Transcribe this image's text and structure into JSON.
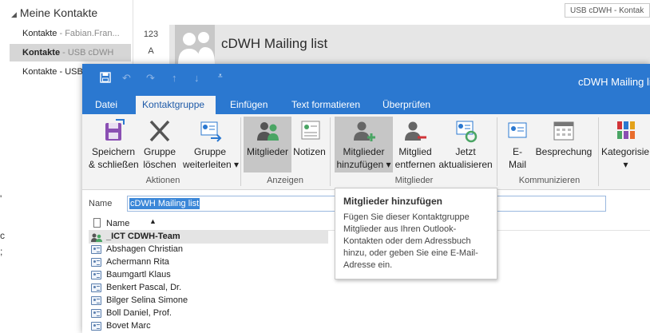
{
  "background": {
    "section_title": "Meine Kontakte",
    "contacts": [
      {
        "name": "Kontakte",
        "sub": " - Fabian.Fran..."
      },
      {
        "name": "Kontakte",
        "sub": " - USB cDWH"
      },
      {
        "name": "Kontakte - USB",
        "sub": ""
      }
    ],
    "index_letters": [
      "123",
      "A"
    ],
    "search_text": "USB cDWH - Kontak",
    "header_title": "cDWH Mailing list",
    "edge_glyphs": [
      "'",
      "c",
      ";"
    ]
  },
  "window": {
    "title": "cDWH Mailing li",
    "tabs": [
      "Datei",
      "Kontaktgruppe",
      "Einfügen",
      "Text formatieren",
      "Überprüfen"
    ],
    "active_tab": "Kontaktgruppe",
    "ribbon": {
      "buttons": {
        "save_close": [
          "Speichern",
          "& schließen"
        ],
        "delete_group": [
          "Gruppe",
          "löschen"
        ],
        "forward_group": [
          "Gruppe",
          "weiterleiten ▾"
        ],
        "members": [
          "Mitglieder"
        ],
        "notes": [
          "Notizen"
        ],
        "add_members": [
          "Mitglieder",
          "hinzufügen ▾"
        ],
        "remove_member": [
          "Mitglied",
          "entfernen"
        ],
        "update_now": [
          "Jetzt",
          "aktualisieren"
        ],
        "email": [
          "E-",
          "Mail"
        ],
        "meeting": [
          "Besprechung"
        ],
        "categorize": [
          "Kategorisie",
          "▾"
        ]
      },
      "groups": {
        "actions": "Aktionen",
        "show": "Anzeigen",
        "members": "Mitglieder",
        "communicate": "Kommunizieren"
      }
    },
    "name_label": "Name",
    "name_value": "cDWH Mailing list",
    "list_header": "Name",
    "members": [
      "_ICT CDWH-Team",
      "Abshagen Christian",
      "Achermann Rita",
      "Baumgartl Klaus",
      "Benkert Pascal, Dr.",
      "Bilger Selina Simone",
      "Boll Daniel, Prof.",
      "Bovet Marc"
    ]
  },
  "tooltip": {
    "title": "Mitglieder hinzufügen",
    "body": "Fügen Sie dieser Kontaktgruppe Mitglieder aus Ihren Outlook-Kontakten oder dem Adressbuch hinzu, oder geben Sie eine E-Mail-Adresse ein."
  },
  "colors": {
    "accent": "#2b78d0",
    "selection": "#3b87d8",
    "pressed": "#c6c6c6"
  }
}
